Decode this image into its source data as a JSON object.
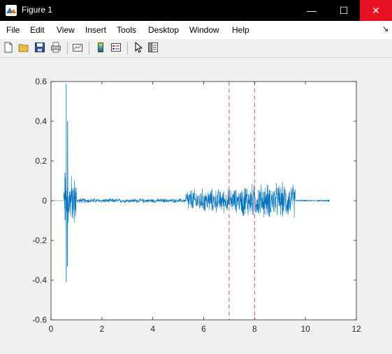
{
  "window": {
    "title": "Figure 1",
    "icon": "matlab-figure-icon"
  },
  "window_controls": {
    "minimize": "—",
    "maximize": "☐",
    "close": "✕"
  },
  "menu": [
    "File",
    "Edit",
    "View",
    "Insert",
    "Tools",
    "Desktop",
    "Window",
    "Help"
  ],
  "menu_overflow": "↘",
  "toolbar": [
    "new-figure-icon",
    "open-file-icon",
    "save-icon",
    "print-icon",
    "link-plot-icon",
    "insert-colorbar-icon",
    "insert-legend-icon",
    "edit-plot-cursor-icon",
    "property-editor-icon"
  ],
  "colors": {
    "signal": "#0072bd",
    "marker_lines": "#d9534f",
    "close_button": "#e81123"
  },
  "chart_data": {
    "type": "line",
    "title": "",
    "xlabel": "",
    "ylabel": "",
    "xlim": [
      0,
      12
    ],
    "ylim": [
      -0.6,
      0.6
    ],
    "xticks": [
      "0",
      "2",
      "4",
      "6",
      "8",
      "10",
      "12"
    ],
    "yticks": [
      "0.6",
      "0.4",
      "0.2",
      "0",
      "-0.2",
      "-0.4",
      "-0.6"
    ],
    "grid": false,
    "vertical_lines": [
      {
        "x": 7,
        "style": "dashed"
      },
      {
        "x": 8,
        "style": "dashed"
      }
    ],
    "signal": {
      "x_start": 0,
      "x_end": 10.9,
      "peaks": [
        {
          "x": 0.6,
          "max": 0.59,
          "min": -0.41
        },
        {
          "x": 0.65,
          "max": 0.4,
          "min": -0.33
        },
        {
          "x": 0.55,
          "max": 0.14,
          "min": -0.1
        }
      ],
      "segments": [
        {
          "x0": 0.0,
          "x1": 0.5,
          "amplitude": 0.0
        },
        {
          "x0": 0.5,
          "x1": 1.0,
          "amplitude": 0.15
        },
        {
          "x0": 1.0,
          "x1": 1.7,
          "amplitude": 0.015
        },
        {
          "x0": 1.7,
          "x1": 5.3,
          "amplitude": 0.012
        },
        {
          "x0": 5.3,
          "x1": 7.5,
          "amplitude": 0.07
        },
        {
          "x0": 7.5,
          "x1": 9.6,
          "amplitude": 0.1
        },
        {
          "x0": 9.6,
          "x1": 10.9,
          "amplitude": 0.004
        }
      ]
    }
  }
}
